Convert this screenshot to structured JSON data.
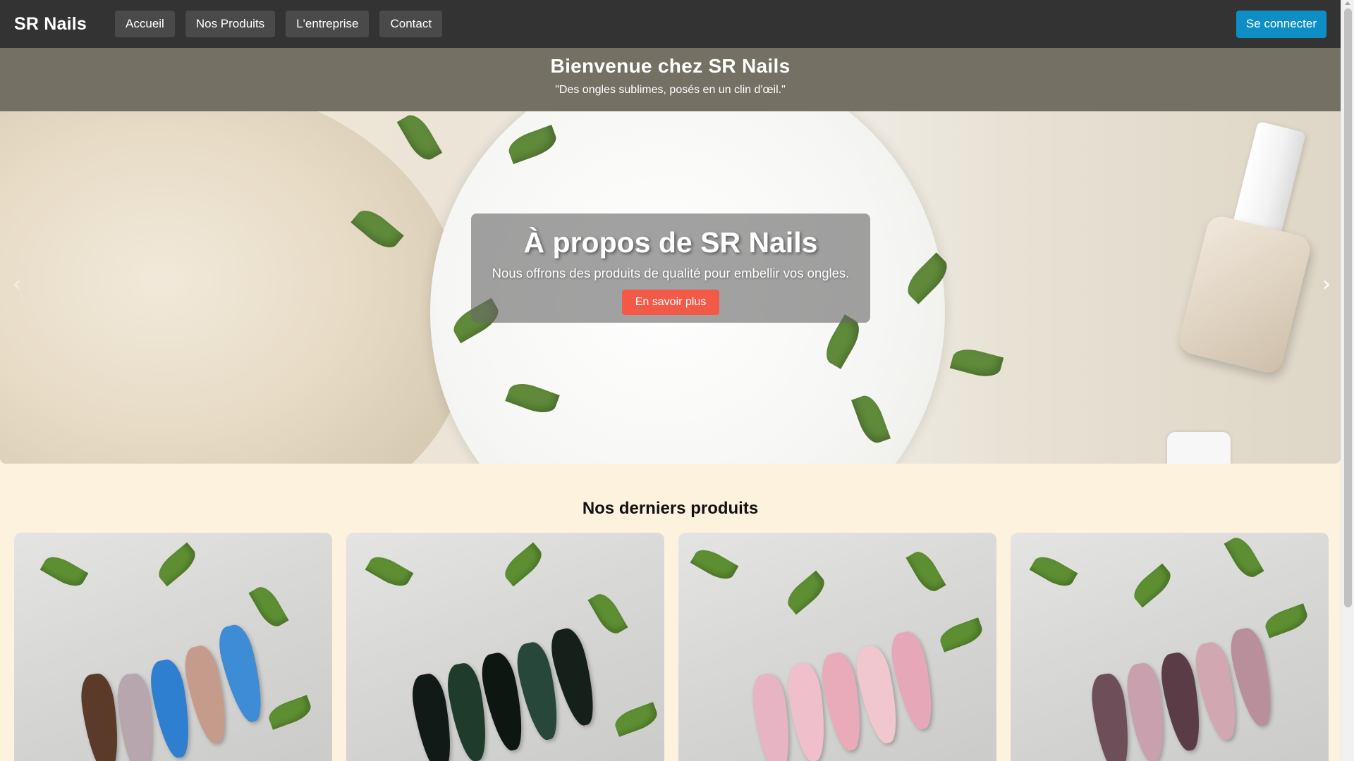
{
  "navbar": {
    "brand": "SR Nails",
    "links": [
      "Accueil",
      "Nos Produits",
      "L'entreprise",
      "Contact"
    ],
    "login_label": "Se connecter"
  },
  "welcome": {
    "title": "Bienvenue chez SR Nails",
    "tagline": "\"Des ongles sublimes, posés en un clin d'œil.\""
  },
  "hero": {
    "title": "À propos de SR Nails",
    "text": "Nous offrons des produits de qualité pour embellir vos ongles.",
    "button_label": "En savoir plus",
    "prev_icon": "‹",
    "next_icon": "›"
  },
  "products": {
    "title": "Nos derniers produits"
  },
  "colors": {
    "navbar": "#333333",
    "login": "#0d8ec5",
    "cta": "#f25a47",
    "page_background": "#fdf2de"
  }
}
